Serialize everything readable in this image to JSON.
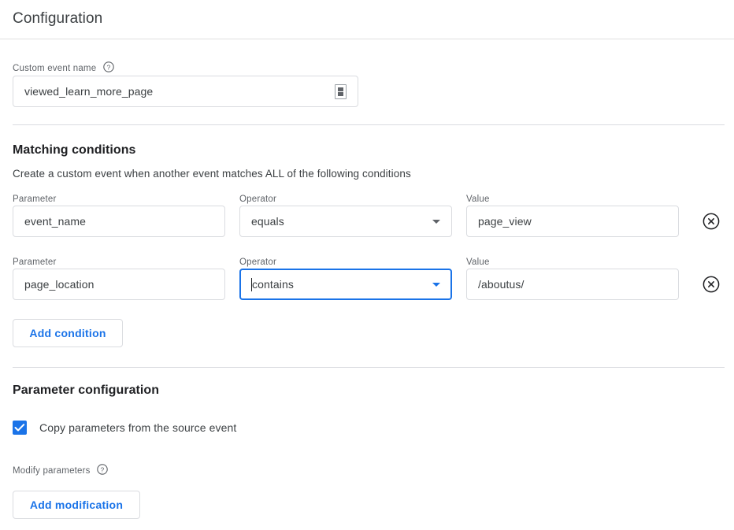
{
  "header": {
    "title": "Configuration"
  },
  "custom_event": {
    "label": "Custom event name",
    "help_icon": "help-circle-icon",
    "value": "viewed_learn_more_page",
    "trailing_icon": "text-field-glyph-icon"
  },
  "matching": {
    "title": "Matching conditions",
    "description": "Create a custom event when another event matches ALL of the following conditions",
    "column_labels": {
      "parameter": "Parameter",
      "operator": "Operator",
      "value": "Value"
    },
    "conditions": [
      {
        "parameter": "event_name",
        "operator": "equals",
        "value": "page_view",
        "focused": false,
        "remove_icon": "remove-circle-x-icon"
      },
      {
        "parameter": "page_location",
        "operator": "contains",
        "value": "/aboutus/",
        "focused": true,
        "remove_icon": "remove-circle-x-icon"
      }
    ],
    "add_condition_label": "Add condition"
  },
  "parameter_config": {
    "title": "Parameter configuration",
    "copy_params": {
      "label": "Copy parameters from the source event",
      "checked": true
    },
    "modify_params": {
      "label": "Modify parameters",
      "help_icon": "help-circle-icon"
    },
    "add_modification_label": "Add modification"
  },
  "colors": {
    "accent_blue": "#1a73e8",
    "border_grey": "#dadce0",
    "text_primary": "#202124",
    "text_secondary": "#5f6368"
  }
}
